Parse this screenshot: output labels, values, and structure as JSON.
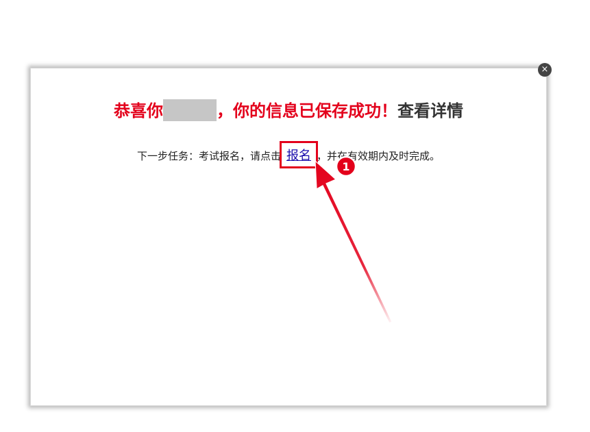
{
  "dialog": {
    "close_glyph": "×",
    "headline": {
      "congrats": "恭喜你",
      "saved_text": "，你的信息已保存成功！",
      "detail_link": "查看详情"
    },
    "subline": {
      "prefix": "下一步任务：考试报名，请点击",
      "register_link": "报名",
      "suffix": "，并在有效期内及时完成。"
    }
  },
  "annotation": {
    "step_number": "1",
    "color": "#e3001b"
  }
}
